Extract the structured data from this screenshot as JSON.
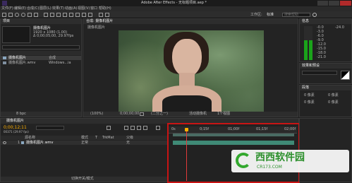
{
  "titlebar": {
    "title": "Adobe After Effects - 无标题项目.aep *"
  },
  "menu": {
    "items": [
      "文件(F)",
      "编辑(E)",
      "合成(C)",
      "图层(L)",
      "效果(T)",
      "动画(A)",
      "视图(V)",
      "窗口",
      "帮助(H)"
    ]
  },
  "toolbar": {
    "workspace_label": "工作区:",
    "workspace_value": "标准",
    "search_placeholder": "搜索帮助"
  },
  "project": {
    "tab": "项目",
    "selected_name": "摄像机图片",
    "selected_info_1": "1920 x 1080 (1.00)",
    "selected_info_2": "Δ 0;00;05;00, 29.97fps",
    "items": [
      {
        "name": "摄像机图片",
        "type": "合成"
      },
      {
        "name": "摄像机图片.wmv",
        "type": "Windows...ia"
      }
    ],
    "footer_bit_depth": "8 bpc"
  },
  "composition": {
    "tab": "合成: 摄像机图片",
    "name_label": "摄像机图片",
    "footer": {
      "zoom": "(100%)",
      "timecode": "0;00;00;00",
      "quality": "(二分之一)",
      "camera": "活动摄像机",
      "view": "1个视图"
    }
  },
  "info_panel": {
    "title": "信息",
    "levels": [
      "-0.0",
      "-3.0",
      "-6.0",
      "-9.0",
      "-12.0",
      "-15.0",
      "-18.0",
      "-21.0",
      "-24.0"
    ]
  },
  "effects_panel": {
    "title": "效果和预设"
  },
  "paragraph_panel": {
    "title": "段落",
    "values": [
      "0 像素",
      "0 像素",
      "0 像素",
      "0 像素"
    ]
  },
  "timeline": {
    "tab": "摄像机图片",
    "timecode": "0;00;12;11",
    "frame_info": "00371 (29.97 fps)",
    "columns": [
      "源名称",
      "模式",
      "T",
      "TrkMat",
      "父级"
    ],
    "layers": [
      {
        "index": "1",
        "name": "摄像机图片.wmv",
        "mode": "正常",
        "parent": "无"
      }
    ],
    "ruler_labels": [
      "0s",
      "0;15f",
      "01;00f",
      "01;15f",
      "02;00f"
    ],
    "footer": "切换开关/模式"
  },
  "watermark": {
    "brand": "西西软件园",
    "url": "CR173.COM"
  },
  "colors": {
    "accent": "#ffb000",
    "highlight_box": "#c81414",
    "work_area": "#4a6b63",
    "layer_bar": "#3f8a76",
    "audio_meter": "#1aa31a"
  }
}
